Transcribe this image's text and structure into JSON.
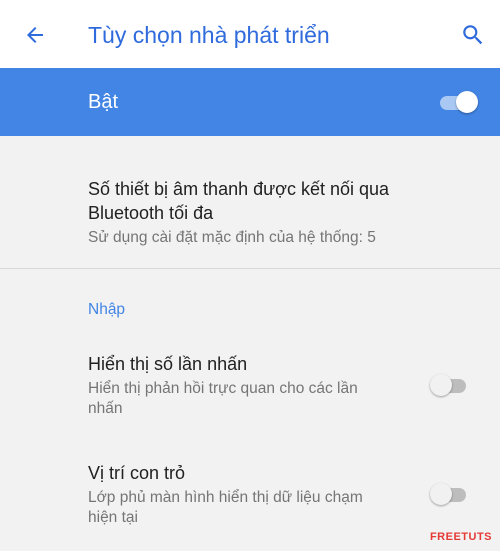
{
  "header": {
    "title": "Tùy chọn nhà phát triển",
    "back_icon": "arrow-back-icon",
    "search_icon": "search-icon"
  },
  "master_switch": {
    "label": "Bật",
    "state": "on"
  },
  "settings": {
    "bluetooth": {
      "title_line1": "Số thiết bị âm thanh được kết nối qua",
      "title_line2": "Bluetooth tối đa",
      "summary": "Sử dụng cài đặt mặc định của hệ thống: 5"
    },
    "input_category": "Nhập",
    "show_taps": {
      "title": "Hiển thị số lần nhấn",
      "summary_line1": "Hiển thị phản hồi trực quan cho các lần",
      "summary_line2": "nhấn",
      "state": "off"
    },
    "pointer_location": {
      "title": "Vị trí con trỏ",
      "summary_line1": "Lớp phủ màn hình hiển thị dữ liệu chạm",
      "summary_line2": "hiện tại",
      "state": "off"
    }
  },
  "watermark": "FREETUTS",
  "colors": {
    "accent": "#4285e4",
    "title_blue": "#2f6bdc",
    "background": "#f2f2f2"
  }
}
